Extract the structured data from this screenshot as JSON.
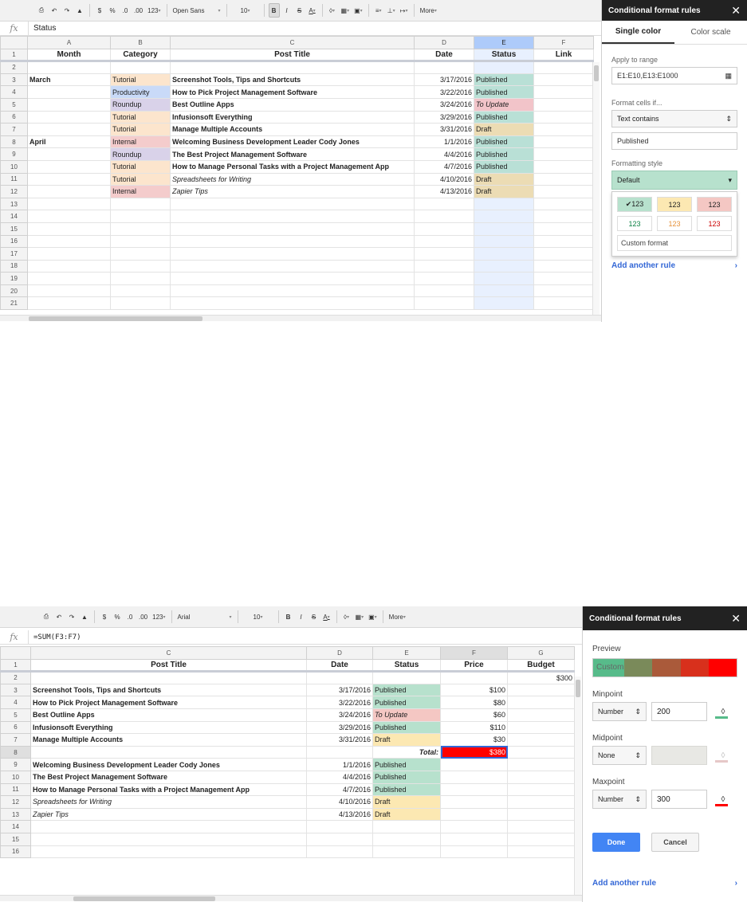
{
  "top": {
    "toolbar": {
      "font": "Open Sans",
      "size": "10",
      "number_format": "123",
      "more": "More",
      "dec_dec": ".0",
      "dec_inc": ".00",
      "currency": "$",
      "percent": "%",
      "bold": "B",
      "italic": "I",
      "strike": "S",
      "color": "A"
    },
    "formula": {
      "fx": "fx",
      "value": "Status"
    },
    "columns": [
      "A",
      "B",
      "C",
      "D",
      "E",
      "F"
    ],
    "rows": [
      {
        "n": "1",
        "cells": [
          "Month",
          "Category",
          "Post Title",
          "Date",
          "Status",
          "Link"
        ]
      },
      {
        "n": "2",
        "cells": [
          "",
          "",
          "",
          "",
          "",
          ""
        ]
      },
      {
        "n": "3",
        "cells": [
          "March",
          "Tutorial",
          "Screenshot Tools, Tips and Shortcuts",
          "3/17/2016",
          "Published",
          ""
        ]
      },
      {
        "n": "4",
        "cells": [
          "",
          "Productivity",
          "How to Pick Project Management Software",
          "3/22/2016",
          "Published",
          ""
        ]
      },
      {
        "n": "5",
        "cells": [
          "",
          "Roundup",
          "Best Outline Apps",
          "3/24/2016",
          "To Update",
          ""
        ]
      },
      {
        "n": "6",
        "cells": [
          "",
          "Tutorial",
          "Infusionsoft Everything",
          "3/29/2016",
          "Published",
          ""
        ]
      },
      {
        "n": "7",
        "cells": [
          "",
          "Tutorial",
          "Manage Multiple Accounts",
          "3/31/2016",
          "Draft",
          ""
        ]
      },
      {
        "n": "8",
        "cells": [
          "April",
          "Internal",
          "Welcoming Business Development Leader Cody Jones",
          "1/1/2016",
          "Published",
          ""
        ]
      },
      {
        "n": "9",
        "cells": [
          "",
          "Roundup",
          "The Best Project Management Software",
          "4/4/2016",
          "Published",
          ""
        ]
      },
      {
        "n": "10",
        "cells": [
          "",
          "Tutorial",
          "How to Manage Personal Tasks with a Project Management App",
          "4/7/2016",
          "Published",
          ""
        ]
      },
      {
        "n": "11",
        "cells": [
          "",
          "Tutorial",
          "Spreadsheets for Writing",
          "4/10/2016",
          "Draft",
          ""
        ]
      },
      {
        "n": "12",
        "cells": [
          "",
          "Internal",
          "Zapier Tips",
          "4/13/2016",
          "Draft",
          ""
        ]
      },
      {
        "n": "13",
        "cells": [
          "",
          "",
          "",
          "",
          "",
          ""
        ]
      },
      {
        "n": "14",
        "cells": [
          "",
          "",
          "",
          "",
          "",
          ""
        ]
      },
      {
        "n": "15",
        "cells": [
          "",
          "",
          "",
          "",
          "",
          ""
        ]
      },
      {
        "n": "16",
        "cells": [
          "",
          "",
          "",
          "",
          "",
          ""
        ]
      },
      {
        "n": "17",
        "cells": [
          "",
          "",
          "",
          "",
          "",
          ""
        ]
      },
      {
        "n": "18",
        "cells": [
          "",
          "",
          "",
          "",
          "",
          ""
        ]
      },
      {
        "n": "19",
        "cells": [
          "",
          "",
          "",
          "",
          "",
          ""
        ]
      },
      {
        "n": "20",
        "cells": [
          "",
          "",
          "",
          "",
          "",
          ""
        ]
      },
      {
        "n": "21",
        "cells": [
          "",
          "",
          "",
          "",
          "",
          ""
        ]
      }
    ],
    "panel": {
      "title": "Conditional format rules",
      "tab_single": "Single color",
      "tab_scale": "Color scale",
      "apply_label": "Apply to range",
      "apply_value": "E1:E10,E13:E1000",
      "cond_label": "Format cells if...",
      "cond_value": "Text contains",
      "text_value": "Published",
      "style_label": "Formatting style",
      "style_value": "Default",
      "swatches": [
        "✔123",
        "123",
        "123",
        "123",
        "123",
        "123"
      ],
      "custom": "Custom format",
      "add_rule": "Add another rule"
    }
  },
  "bottom": {
    "toolbar": {
      "font": "Arial",
      "size": "10",
      "number_format": "123",
      "more": "More",
      "dec_dec": ".0",
      "dec_inc": ".00",
      "currency": "$",
      "percent": "%",
      "bold": "B",
      "italic": "I",
      "strike": "S",
      "color": "A"
    },
    "formula": {
      "fx": "fx",
      "value": "=SUM(F3:F7)"
    },
    "columns": [
      "C",
      "D",
      "E",
      "F",
      "G"
    ],
    "rows": [
      {
        "n": "1",
        "cells": [
          "Post Title",
          "Date",
          "Status",
          "Price",
          "Budget"
        ]
      },
      {
        "n": "2",
        "cells": [
          "",
          "",
          "",
          "",
          "$300"
        ]
      },
      {
        "n": "3",
        "cells": [
          "Screenshot Tools, Tips and Shortcuts",
          "3/17/2016",
          "Published",
          "$100",
          ""
        ]
      },
      {
        "n": "4",
        "cells": [
          "How to Pick Project Management Software",
          "3/22/2016",
          "Published",
          "$80",
          ""
        ]
      },
      {
        "n": "5",
        "cells": [
          "Best Outline Apps",
          "3/24/2016",
          "To Update",
          "$60",
          ""
        ]
      },
      {
        "n": "6",
        "cells": [
          "Infusionsoft Everything",
          "3/29/2016",
          "Published",
          "$110",
          ""
        ]
      },
      {
        "n": "7",
        "cells": [
          "Manage Multiple Accounts",
          "3/31/2016",
          "Draft",
          "$30",
          ""
        ]
      },
      {
        "n": "8",
        "cells": [
          "",
          "",
          "Total:",
          "$380",
          ""
        ]
      },
      {
        "n": "9",
        "cells": [
          "Welcoming Business Development Leader Cody Jones",
          "1/1/2016",
          "Published",
          "",
          ""
        ]
      },
      {
        "n": "10",
        "cells": [
          "The Best Project Management Software",
          "4/4/2016",
          "Published",
          "",
          ""
        ]
      },
      {
        "n": "11",
        "cells": [
          "How to Manage Personal Tasks with a Project Management App",
          "4/7/2016",
          "Published",
          "",
          ""
        ]
      },
      {
        "n": "12",
        "cells": [
          "Spreadsheets for Writing",
          "4/10/2016",
          "Draft",
          "",
          ""
        ]
      },
      {
        "n": "13",
        "cells": [
          "Zapier Tips",
          "4/13/2016",
          "Draft",
          "",
          ""
        ]
      },
      {
        "n": "14",
        "cells": [
          "",
          "",
          "",
          "",
          ""
        ]
      },
      {
        "n": "15",
        "cells": [
          "",
          "",
          "",
          "",
          ""
        ]
      },
      {
        "n": "16",
        "cells": [
          "",
          "",
          "",
          "",
          ""
        ]
      }
    ],
    "panel": {
      "title": "Conditional format rules",
      "preview_label": "Preview",
      "preview_text": "Custom",
      "min_label": "Minpoint",
      "min_type": "Number",
      "min_value": "200",
      "mid_label": "Midpoint",
      "mid_type": "None",
      "max_label": "Maxpoint",
      "max_type": "Number",
      "max_value": "300",
      "done": "Done",
      "cancel": "Cancel",
      "add_rule": "Add another rule"
    }
  },
  "colors": {
    "published": "#b7e1cd",
    "draft": "#fce8b2",
    "to_update": "#f4c7c3",
    "total": "#ff0000",
    "accent": "#4285f4",
    "min_color": "#57bb8a",
    "max_color": "#ff0000"
  }
}
